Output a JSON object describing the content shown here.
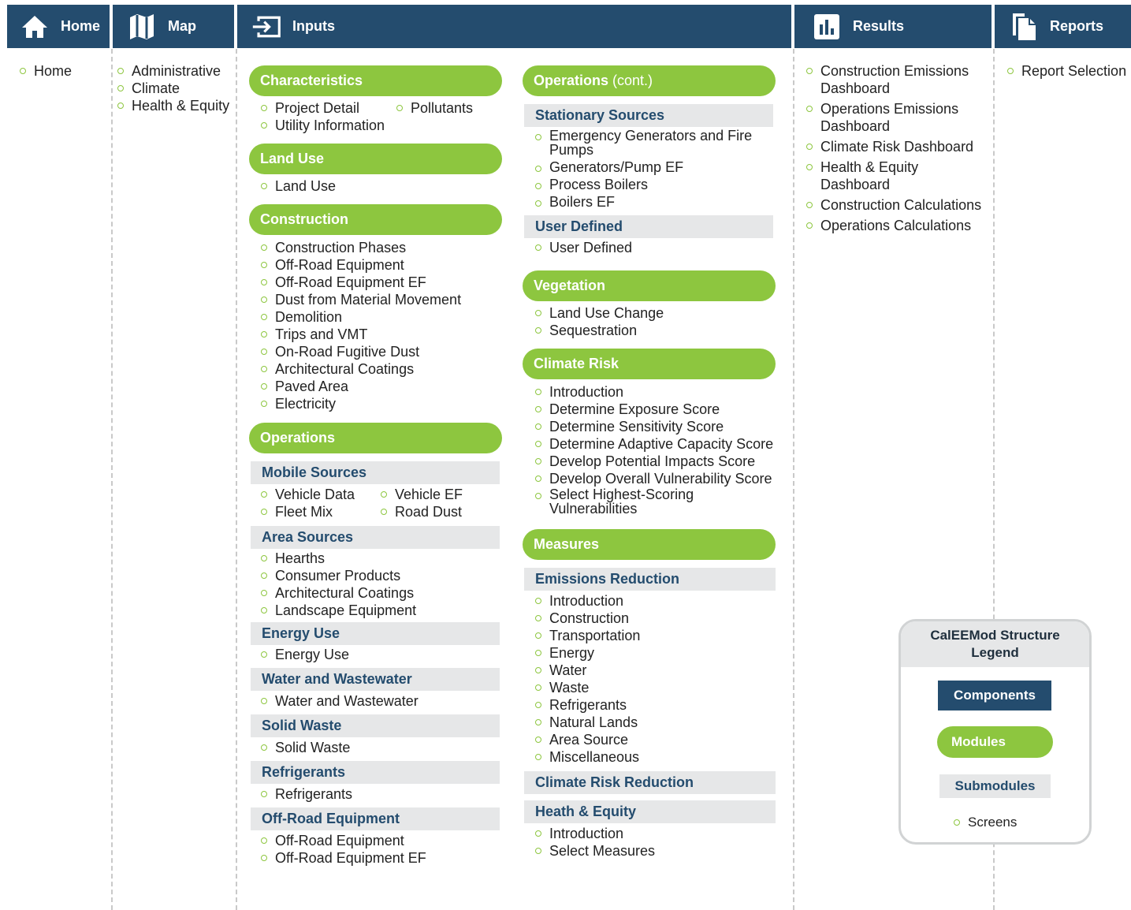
{
  "colors": {
    "component": "#244c6e",
    "module": "#8dc63f",
    "submodule": "#e6e7e8"
  },
  "components": [
    {
      "label": "Home",
      "icon": "house-icon",
      "screens": [
        "Home"
      ]
    },
    {
      "label": "Map",
      "icon": "map-icon",
      "screens": [
        "Administrative",
        "Climate",
        "Health & Equity"
      ]
    },
    {
      "label": "Inputs",
      "icon": "input-arrow-icon"
    },
    {
      "label": "Results",
      "icon": "bar-chart-icon",
      "screens": [
        "Construction Emissions Dashboard",
        "Operations Emissions Dashboard",
        "Climate Risk Dashboard",
        "Health & Equity Dashboard",
        "Construction Calculations",
        "Operations Calculations"
      ]
    },
    {
      "label": "Reports",
      "icon": "document-icon",
      "screens": [
        "Report Selection"
      ]
    }
  ],
  "inputs_left": {
    "characteristics": {
      "label": "Characteristics",
      "col1": [
        "Project Detail",
        "Utility Information"
      ],
      "col2": [
        "Pollutants"
      ]
    },
    "land_use": {
      "label": "Land Use",
      "screens": [
        "Land Use"
      ]
    },
    "construction": {
      "label": "Construction",
      "screens": [
        "Construction Phases",
        "Off-Road Equipment",
        "Off-Road Equipment EF",
        "Dust from Material Movement",
        "Demolition",
        "Trips and VMT",
        "On-Road Fugitive Dust",
        "Architectural Coatings",
        "Paved Area",
        "Electricity"
      ]
    },
    "operations": {
      "label": "Operations",
      "mobile": {
        "label": "Mobile Sources",
        "col1": [
          "Vehicle Data",
          "Fleet Mix"
        ],
        "col2": [
          "Vehicle EF",
          "Road Dust"
        ]
      },
      "area": {
        "label": "Area Sources",
        "screens": [
          "Hearths",
          "Consumer Products",
          "Architectural Coatings",
          "Landscape Equipment"
        ]
      },
      "energy": {
        "label": "Energy Use",
        "screens": [
          "Energy Use"
        ]
      },
      "water": {
        "label": "Water and Wastewater",
        "screens": [
          "Water and Wastewater"
        ]
      },
      "solid": {
        "label": "Solid Waste",
        "screens": [
          "Solid Waste"
        ]
      },
      "refrig": {
        "label": "Refrigerants",
        "screens": [
          "Refrigerants"
        ]
      },
      "offroad": {
        "label": "Off-Road Equipment",
        "screens": [
          "Off-Road Equipment",
          "Off-Road Equipment EF"
        ]
      }
    }
  },
  "inputs_right": {
    "ops_cont": {
      "label": "Operations",
      "suffix": "(cont.)",
      "stationary": {
        "label": "Stationary Sources",
        "screens": [
          "Emergency Generators and Fire Pumps",
          "Generators/Pump EF",
          "Process Boilers",
          "Boilers EF"
        ]
      },
      "user": {
        "label": "User Defined",
        "screens": [
          "User Defined"
        ]
      }
    },
    "vegetation": {
      "label": "Vegetation",
      "screens": [
        "Land Use Change",
        "Sequestration"
      ]
    },
    "climate_risk": {
      "label": "Climate Risk",
      "screens": [
        "Introduction",
        "Determine Exposure Score",
        "Determine Sensitivity Score",
        "Determine Adaptive Capacity Score",
        "Develop Potential Impacts Score",
        "Develop Overall Vulnerability Score",
        "Select Highest-Scoring Vulnerabilities"
      ]
    },
    "measures": {
      "label": "Measures",
      "emissions": {
        "label": "Emissions Reduction",
        "screens": [
          "Introduction",
          "Construction",
          "Transportation",
          "Energy",
          "Water",
          "Waste",
          "Refrigerants",
          "Natural Lands",
          "Area Source",
          "Miscellaneous"
        ]
      },
      "climate_red": {
        "label": "Climate Risk Reduction"
      },
      "health": {
        "label": "Heath & Equity",
        "screens": [
          "Introduction",
          "Select Measures"
        ]
      }
    }
  },
  "legend": {
    "title_line1": "CalEEMod Structure",
    "title_line2": "Legend",
    "components": "Components",
    "modules": "Modules",
    "submodules": "Submodules",
    "screens": "Screens"
  }
}
